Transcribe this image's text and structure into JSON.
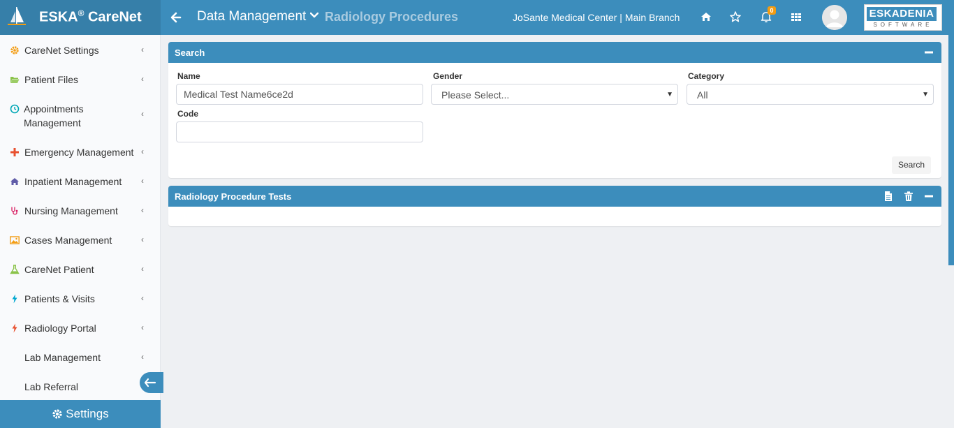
{
  "app": {
    "brand_name": "ESKA",
    "brand_reg": "®",
    "brand_suffix": " CareNet"
  },
  "header": {
    "module": "Data Management",
    "page_title": "Radiology Procedures",
    "facility": "JoSante Medical Center | Main Branch",
    "notification_count": "0",
    "vendor_logo_top": "ESKADENIA",
    "vendor_logo_bottom": "SOFTWARE"
  },
  "sidebar": {
    "items": [
      {
        "label": "CareNet Settings",
        "icon": "gear-icon",
        "color": "#f39c12"
      },
      {
        "label": "Patient Files",
        "icon": "folder-open-icon",
        "color": "#8bc34a"
      },
      {
        "label": "Appointments Management",
        "icon": "clock-icon",
        "color": "#00a7b5"
      },
      {
        "label": "Emergency Management",
        "icon": "plus-icon",
        "color": "#e8502f"
      },
      {
        "label": "Inpatient Management",
        "icon": "home-icon",
        "color": "#605ca8"
      },
      {
        "label": "Nursing Management",
        "icon": "stethoscope-icon",
        "color": "#d81b60"
      },
      {
        "label": "Cases Management",
        "icon": "image-icon",
        "color": "#f39c12"
      },
      {
        "label": "CareNet Patient",
        "icon": "flask-icon",
        "color": "#8bc34a"
      },
      {
        "label": "Patients & Visits",
        "icon": "bolt-icon",
        "color": "#00a7d0"
      },
      {
        "label": "Radiology Portal",
        "icon": "bolt-icon",
        "color": "#e8502f"
      },
      {
        "label": "Lab Management",
        "icon": "",
        "color": ""
      },
      {
        "label": "Lab Referral",
        "icon": "",
        "color": ""
      }
    ],
    "settings_label": "Settings"
  },
  "search_panel": {
    "title": "Search",
    "name_label": "Name",
    "name_value": "Medical Test Name6ce2d",
    "gender_label": "Gender",
    "gender_value": "Please Select...",
    "category_label": "Category",
    "category_value": "All",
    "code_label": "Code",
    "code_value": "",
    "search_button": "Search"
  },
  "results_panel": {
    "title": "Radiology Procedure Tests"
  },
  "colors": {
    "header_blue": "#3c8dbc",
    "brand_blue": "#367fa9",
    "badge_orange": "#f39c12"
  }
}
